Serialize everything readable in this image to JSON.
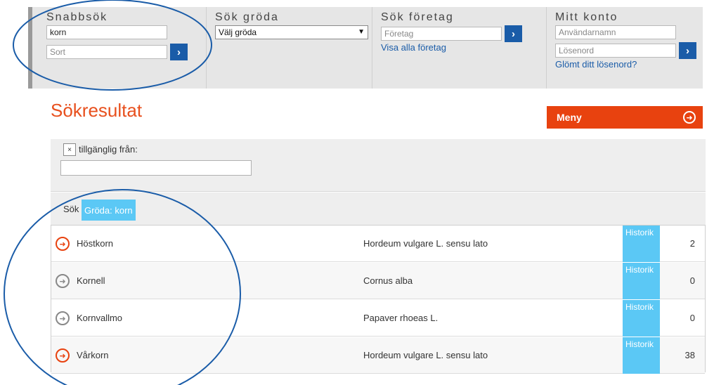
{
  "header": {
    "snabbsok": {
      "title": "Snabbsök",
      "query_value": "korn",
      "sort_placeholder": "Sort",
      "go": "›"
    },
    "gröda": {
      "title": "Sök gröda",
      "select_value": "Välj gröda"
    },
    "foretag": {
      "title": "Sök företag",
      "placeholder": "Företag",
      "go": "›",
      "link": "Visa alla företag"
    },
    "konto": {
      "title": "Mitt konto",
      "user_placeholder": "Användarnamn",
      "pass_placeholder": "Lösenord",
      "go": "›",
      "forgot_link": "Glömt ditt lösenord?"
    }
  },
  "page": {
    "title": "Sökresultat",
    "menu_label": "Meny"
  },
  "filter": {
    "clear": "×",
    "label": "tillgänglig från:"
  },
  "crumbs": {
    "label": "Sök",
    "tag": "Gröda: korn"
  },
  "results": [
    {
      "name": "Höstkorn",
      "scientific": "Hordeum vulgare L. sensu lato",
      "history": "Historik",
      "count": "2",
      "active": true
    },
    {
      "name": "Kornell",
      "scientific": "Cornus alba",
      "history": "Historik",
      "count": "0",
      "active": false
    },
    {
      "name": "Kornvallmo",
      "scientific": "Papaver rhoeas L.",
      "history": "Historik",
      "count": "0",
      "active": false
    },
    {
      "name": "Vårkorn",
      "scientific": "Hordeum vulgare L. sensu lato",
      "history": "Historik",
      "count": "38",
      "active": true
    }
  ],
  "colors": {
    "accent": "#e8420f",
    "link": "#1a5ca8",
    "highlight": "#5bc8f5",
    "annotation": "#1a5ca8"
  }
}
